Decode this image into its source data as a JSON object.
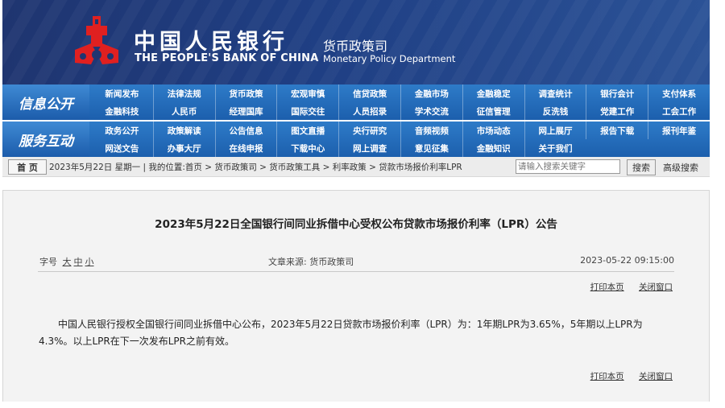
{
  "header": {
    "cn_name": "中国人民银行",
    "en_name": "THE PEOPLE'S BANK OF CHINA",
    "dept_cn": "货币政策司",
    "dept_en": "Monetary Policy Department"
  },
  "nav": {
    "info_label": "信息公开",
    "info_items": [
      "新闻发布",
      "法律法规",
      "货币政策",
      "宏观审慎",
      "信贷政策",
      "金融市场",
      "金融稳定",
      "调查统计",
      "银行会计",
      "支付体系",
      "金融科技",
      "人民币",
      "经理国库",
      "国际交往",
      "人员招录",
      "学术交流",
      "征信管理",
      "反洗钱",
      "党建工作",
      "工会工作"
    ],
    "service_label": "服务互动",
    "service_items": [
      "政务公开",
      "政策解读",
      "公告信息",
      "图文直播",
      "央行研究",
      "音频视频",
      "市场动态",
      "网上展厅",
      "报告下载",
      "报刊年鉴",
      "网送文告",
      "办事大厅",
      "在线申报",
      "下载中心",
      "网上调查",
      "意见征集",
      "金融知识",
      "关于我们"
    ]
  },
  "crumb": {
    "home": "首 页",
    "text": "2023年5月22日 星期一 | 我的位置:首页 > 货币政策司 > 货币政策工具 > 利率政策 > 贷款市场报价利率LPR",
    "search_placeholder": "请输入搜索关键字",
    "search_btn": "搜索",
    "adv_search": "高级搜索"
  },
  "article": {
    "title": "2023年5月22日全国银行间同业拆借中心受权公布贷款市场报价利率（LPR）公告",
    "font_label": "字号",
    "font_large": "大",
    "font_medium": "中",
    "font_small": "小",
    "source": "文章来源:  货币政策司",
    "date": "2023-05-22 09:15:00",
    "print": "打印本页",
    "close": "关闭窗口",
    "body": "中国人民银行授权全国银行间同业拆借中心公布，2023年5月22日贷款市场报价利率（LPR）为：1年期LPR为3.65%，5年期以上LPR为4.3%。以上LPR在下一次发布LPR之前有效。"
  }
}
